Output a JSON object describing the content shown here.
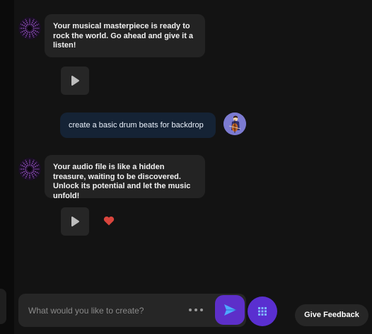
{
  "chat": {
    "messages": [
      {
        "text": "Your musical masterpiece is ready to rock the world. Go ahead and give it a listen!"
      },
      {
        "text": "create a basic drum beats for backdrop"
      },
      {
        "text": "Your audio file is like a hidden treasure, waiting to be discovered. Unlock its potential and let the music unfold!"
      }
    ]
  },
  "composer": {
    "placeholder": "What would you like to create?"
  },
  "feedback": {
    "label": "Give Feedback"
  },
  "icons": {
    "bot_avatar": "radial-burst-avatar",
    "user_avatar": "cellist-avatar",
    "play": "play-icon",
    "like": "heart-icon",
    "more": "more-dots-icon",
    "send": "send-icon",
    "apps": "grid-icon"
  },
  "colors": {
    "accent": "#5d2fc9",
    "user_bubble": "#152335",
    "bot_bubble": "#232323",
    "heart": "#d9453d"
  }
}
